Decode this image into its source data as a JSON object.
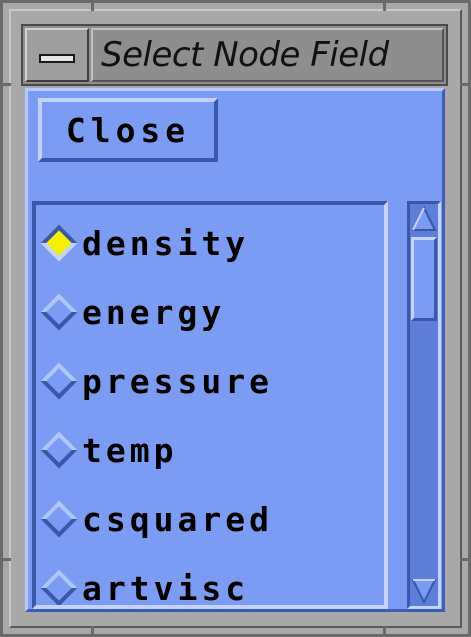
{
  "window": {
    "title": "Select Node Field"
  },
  "icons": {
    "menu": "window-menu-icon",
    "selected": "radio-diamond-selected",
    "unselected": "radio-diamond-unselected"
  },
  "colors": {
    "panel": "#7b9cf2",
    "selected_radio": "#f4f000",
    "titlebar": "#8e8e8e"
  },
  "close_label": "Close",
  "fields": [
    {
      "label": "density",
      "selected": true
    },
    {
      "label": "energy",
      "selected": false
    },
    {
      "label": "pressure",
      "selected": false
    },
    {
      "label": "temp",
      "selected": false
    },
    {
      "label": "csquared",
      "selected": false
    },
    {
      "label": "artvisc",
      "selected": false
    }
  ],
  "scroll_position": 0
}
